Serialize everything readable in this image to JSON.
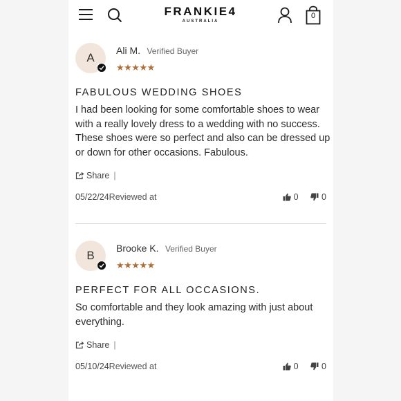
{
  "header": {
    "brand": "FRANKIE4",
    "brand_sub": "AUSTRALIA",
    "cart_count": "0",
    "icons": [
      "menu-icon",
      "search-icon",
      "user-icon",
      "bag-icon"
    ]
  },
  "colors": {
    "star": "#b0703a",
    "avatar_bg": "#f2e6dc",
    "divider": "#d8d8d8"
  },
  "reviews": [
    {
      "initial": "A",
      "name": "Ali M.",
      "verified": "Verified Buyer",
      "rating": 5,
      "stars": "★★★★★",
      "title": "FABULOUS WEDDING SHOES",
      "body": "I had been looking for some comfortable shoes to wear with a really lovely dress to a wedding with no success. These shoes were so perfect and also can be dressed up or down for other occasions. Fabulous.",
      "share": "Share",
      "date": "05/22/24",
      "reviewed_label": "Reviewed at",
      "helpful_yes": "0",
      "helpful_no": "0"
    },
    {
      "initial": "B",
      "name": "Brooke K.",
      "verified": "Verified Buyer",
      "rating": 5,
      "stars": "★★★★★",
      "title": "PERFECT FOR ALL OCCASIONS.",
      "body": "So comfortable and they look amazing with just about everything.",
      "share": "Share",
      "date": "05/10/24",
      "reviewed_label": "Reviewed at",
      "helpful_yes": "0",
      "helpful_no": "0"
    }
  ]
}
